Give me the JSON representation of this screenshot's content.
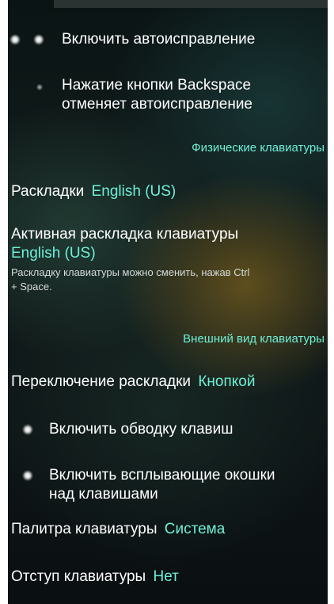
{
  "colors": {
    "accent": "#6ef0d8",
    "text": "#ffffff"
  },
  "autocorrect": {
    "enable_label": "Включить автоисправление",
    "backspace_label_line1": "Нажатие кнопки Backspace",
    "backspace_label_line2": "отменяет автоисправление"
  },
  "physical": {
    "section_title": "Физические клавиатуры",
    "layouts_label": "Раскладки",
    "layouts_value": "English (US)",
    "active_label": "Активная раскладка клавиатуры",
    "active_value": "English (US)",
    "active_hint_line1": "Раскладку клавиатуры можно сменить, нажав Ctrl",
    "active_hint_line2": "+ Space."
  },
  "appearance": {
    "section_title": "Внешний вид клавиатуры",
    "switch_label": "Переключение раскладки",
    "switch_value": "Кнопкой",
    "key_border_label": "Включить обводку клавиш",
    "popup_label_line1": "Включить всплывающие окошки",
    "popup_label_line2": "над клавишами",
    "palette_label": "Палитра клавиатуры",
    "palette_value": "Система",
    "padding_label": "Отступ клавиатуры",
    "padding_value": "Нет"
  }
}
